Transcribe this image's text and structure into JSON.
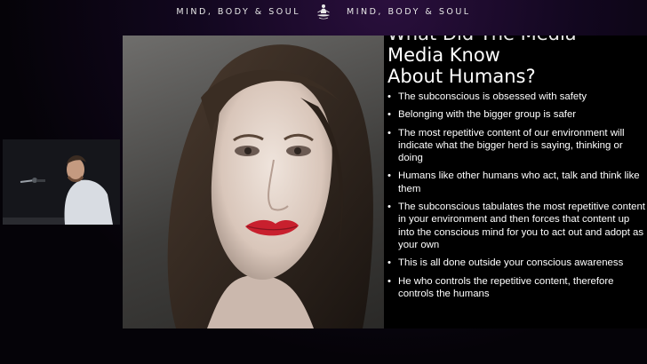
{
  "header": {
    "left_text": "MIND, BODY & SOUL",
    "right_text": "MIND, BODY & SOUL",
    "logo_icon": "lotus-meditation-icon"
  },
  "slide": {
    "title_partial_line": "What Did The Media",
    "title_line2": "Media Know",
    "title_line3": "About Humans?",
    "bullets": [
      "The subconscious is obsessed with safety",
      "Belonging with the bigger group is safer",
      "The most repetitive content of our environment will indicate what the bigger herd is saying, thinking or doing",
      "Humans like other humans who act, talk and think like them",
      "The subconscious tabulates the most repetitive content in your environment and then forces that content up into the conscious mind for you to act out and adopt as your own",
      "This is all done outside your conscious awareness",
      "He who controls the repetitive content, therefore controls the humans"
    ]
  },
  "colors": {
    "background_top": "#2a0f3d",
    "background_base": "#050308",
    "text": "#ffffff",
    "lips": "#c8202e"
  }
}
